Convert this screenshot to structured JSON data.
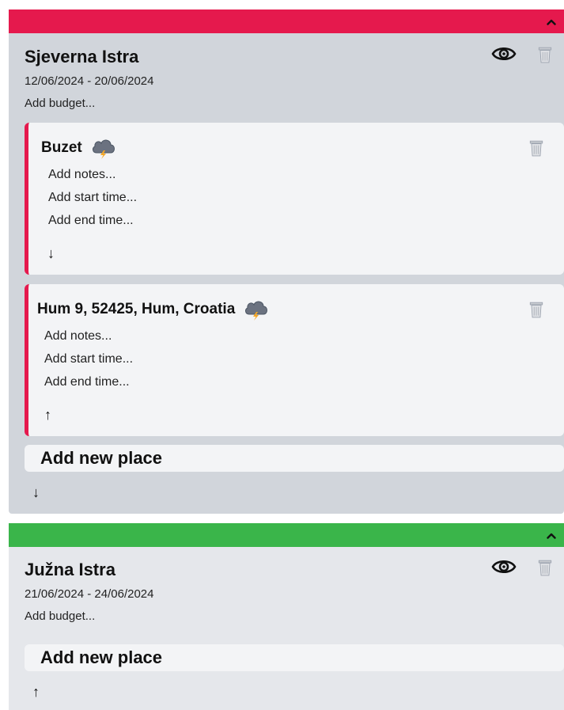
{
  "colors": {
    "trip1_accent": "#e5194d",
    "trip2_accent": "#3ab54a",
    "trip1_bg": "#d1d5db",
    "trip2_bg": "#e5e7eb",
    "card_bg": "#f3f4f6"
  },
  "icons": {
    "collapse": "chevron-up-icon",
    "visibility": "eye-icon",
    "delete": "trash-icon",
    "weather": "storm-cloud-icon"
  },
  "trips": [
    {
      "title": "Sjeverna Istra",
      "dates": "12/06/2024 - 20/06/2024",
      "budget_placeholder": "Add budget...",
      "places": [
        {
          "name": "Buzet",
          "notes_placeholder": "Add notes...",
          "start_placeholder": "Add start time...",
          "end_placeholder": "Add end time...",
          "move_arrow": "↓"
        },
        {
          "name": "Hum 9, 52425, Hum, Croatia",
          "notes_placeholder": "Add notes...",
          "start_placeholder": "Add start time...",
          "end_placeholder": "Add end time...",
          "move_arrow": "↑"
        }
      ],
      "add_place_label": "Add new place",
      "move_arrow": "↓"
    },
    {
      "title": "Južna Istra",
      "dates": "21/06/2024 - 24/06/2024",
      "budget_placeholder": "Add budget...",
      "places": [],
      "add_place_label": "Add new place",
      "move_arrow": "↑"
    }
  ]
}
